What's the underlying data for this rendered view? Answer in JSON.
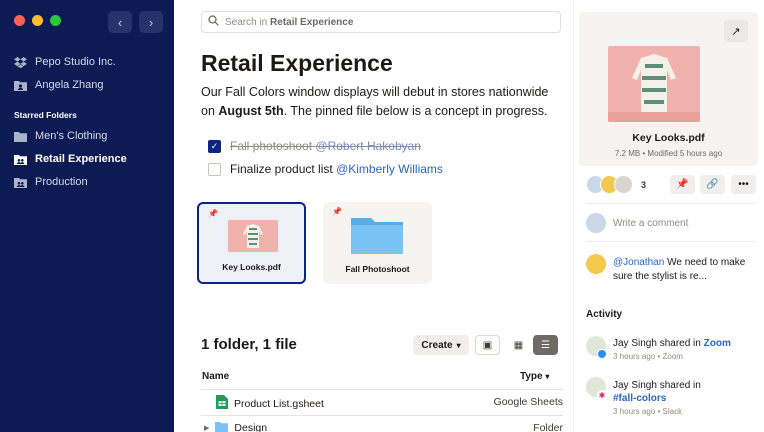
{
  "sidebar": {
    "items": [
      {
        "label": "Pepo Studio Inc.",
        "icon": "dropbox-icon"
      },
      {
        "label": "Angela Zhang",
        "icon": "person-folder-icon"
      }
    ],
    "starred_heading": "Starred Folders",
    "starred": [
      {
        "label": "Men's Clothing",
        "icon": "folder-icon"
      },
      {
        "label": "Retail Experience",
        "icon": "shared-folder-icon",
        "active": true
      },
      {
        "label": "Production",
        "icon": "shared-folder-icon"
      }
    ]
  },
  "search": {
    "prefix": "Search in",
    "scope": "Retail Experience"
  },
  "page": {
    "title": "Retail Experience",
    "desc_pre": "Our Fall Colors window displays will debut in stores nationwide on",
    "desc_bold": "August 5th",
    "desc_post": ". The pinned file below is a concept in progress."
  },
  "tasks": [
    {
      "text": "Fall photoshoot",
      "mention": "@Robert Hakobyan",
      "done": true
    },
    {
      "text": "Finalize product list",
      "mention": "@Kimberly Williams",
      "done": false
    }
  ],
  "pinned": [
    {
      "label": "Key Looks.pdf"
    },
    {
      "label": "Fall Photoshoot"
    }
  ],
  "listing": {
    "summary": "1 folder, 1 file",
    "create_label": "Create",
    "col_name": "Name",
    "col_type": "Type",
    "rows": [
      {
        "name": "Product List.gsheet",
        "type": "Google Sheets"
      },
      {
        "name": "Design",
        "type": "Folder"
      }
    ]
  },
  "preview": {
    "name": "Key Looks.pdf",
    "meta": "7.2 MB • Modified 5 hours ago",
    "avatar_count": "3"
  },
  "comments": {
    "placeholder": "Write a comment",
    "mention": "@Jonathan",
    "text": " We need to make sure the stylist is re..."
  },
  "activity": {
    "title": "Activity",
    "items": [
      {
        "who": "Jay Singh shared in",
        "where": "Zoom",
        "sub": "3 hours ago • Zoom"
      },
      {
        "who": "Jay Singh shared in",
        "where": "#fall-colors",
        "sub": "3 hours ago • Slack"
      }
    ]
  },
  "colors": {
    "sidebar": "#0d1b54",
    "accent": "#0d2481",
    "link": "#2a64c6",
    "pink": "#f0b2ad",
    "folder": "#7cc3f5"
  }
}
